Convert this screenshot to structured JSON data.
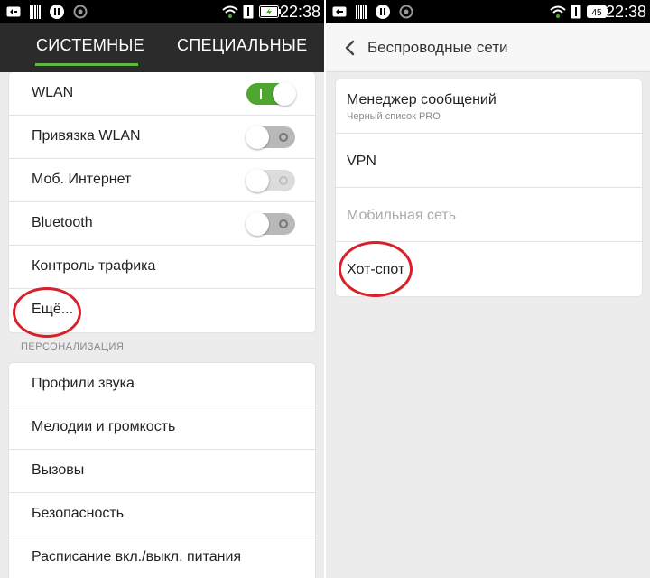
{
  "left_screen": {
    "status_bar": {
      "time": "22:38"
    },
    "tabs": [
      {
        "label": "СИСТЕМНЫЕ",
        "active": true
      },
      {
        "label": "СПЕЦИАЛЬНЫЕ",
        "active": false
      }
    ],
    "main_settings": [
      {
        "label": "WLAN",
        "toggle": "on"
      },
      {
        "label": "Привязка WLAN",
        "toggle": "off"
      },
      {
        "label": "Моб. Интернет",
        "toggle": "off-disabled"
      },
      {
        "label": "Bluetooth",
        "toggle": "off"
      },
      {
        "label": "Контроль трафика"
      },
      {
        "label": "Ещё..."
      }
    ],
    "section_header": "ПЕРСОНАЛИЗАЦИЯ",
    "personalization_settings": [
      {
        "label": "Профили звука"
      },
      {
        "label": "Мелодии и громкость"
      },
      {
        "label": "Вызовы"
      },
      {
        "label": "Безопасность"
      },
      {
        "label": "Расписание вкл./выкл. питания"
      }
    ]
  },
  "right_screen": {
    "status_bar": {
      "time": "22:38",
      "battery": "45"
    },
    "title": "Беспроводные сети",
    "items": [
      {
        "label": "Менеджер сообщений",
        "sublabel": "Черный список PRO"
      },
      {
        "label": "VPN"
      },
      {
        "label": "Мобильная сеть",
        "disabled": true
      },
      {
        "label": "Хот-спот"
      }
    ]
  },
  "colors": {
    "accent_green": "#4ea62f",
    "tab_underline": "#5fb840",
    "annotation_red": "#d6212b",
    "tab_bar": "#2b2b2b"
  }
}
